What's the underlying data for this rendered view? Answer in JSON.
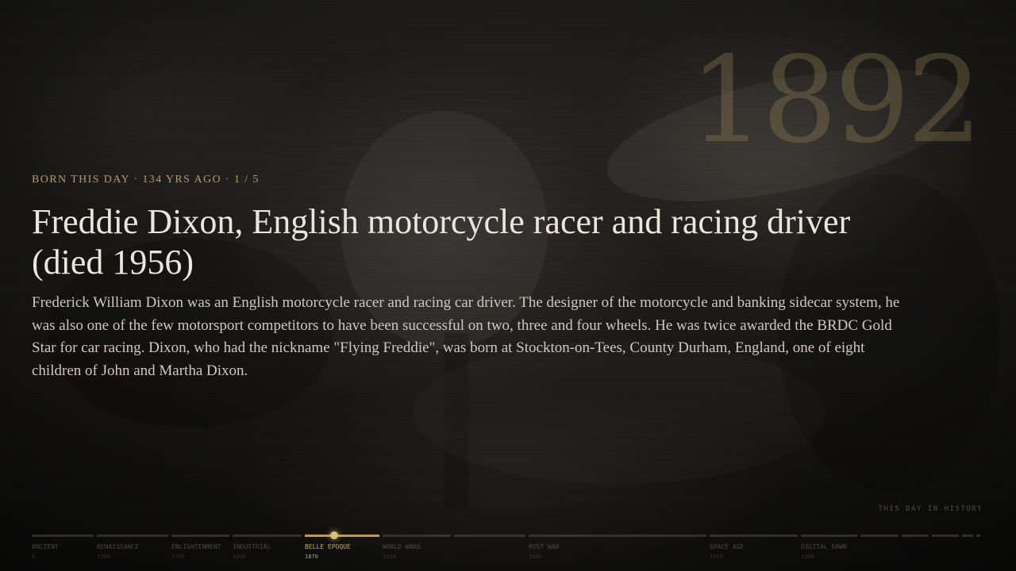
{
  "year": "1892",
  "eyebrow": "BORN THIS DAY · 134 YRS AGO · 1 / 5",
  "title": "Freddie Dixon, English motorcycle racer and racing driver (died 1956)",
  "description": "Frederick William Dixon was an English motorcycle racer and racing car driver. The designer of the motorcycle and banking sidecar system, he was also one of the few motorsport competitors to have been successful on two, three and four wheels. He was twice awarded the BRDC Gold Star for car racing. Dixon, who had the nickname \"Flying Freddie\", was born at Stockton-on-Tees, County Durham, England, one of eight children of John and Martha Dixon.",
  "brand": "THIS DAY IN HISTORY",
  "colors": {
    "accent": "#b79a5e",
    "active_era": "#c9aa68",
    "title": "#ebe6dc",
    "body": "#cfc9bd"
  },
  "timeline": {
    "active_index": 4,
    "eras": [
      {
        "name": "ANCIENT",
        "year": "0"
      },
      {
        "name": "RENAISSANCE",
        "year": "1500"
      },
      {
        "name": "ENLIGHTENMENT",
        "year": "1700"
      },
      {
        "name": "INDUSTRIAL",
        "year": "1800"
      },
      {
        "name": "BELLE EPOQUE",
        "year": "1870"
      },
      {
        "name": "WORLD WARS",
        "year": "1914"
      },
      {
        "name": "",
        "year": ""
      },
      {
        "name": "POST WAR",
        "year": "1945"
      },
      {
        "name": "SPACE AGE",
        "year": "1969"
      },
      {
        "name": "DIGITAL DAWN",
        "year": "1990"
      },
      {
        "name": "",
        "year": ""
      },
      {
        "name": "",
        "year": ""
      },
      {
        "name": "",
        "year": ""
      },
      {
        "name": "",
        "year": ""
      },
      {
        "name": "",
        "year": ""
      }
    ]
  }
}
